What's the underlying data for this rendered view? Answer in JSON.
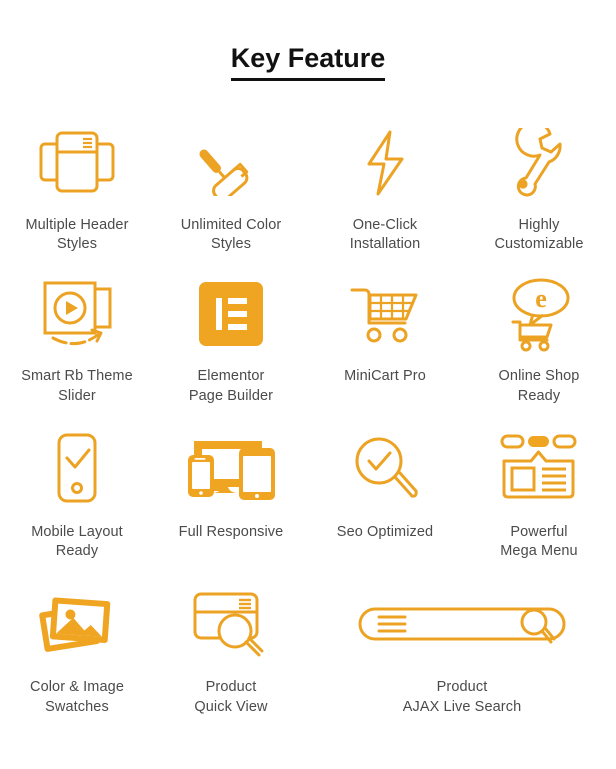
{
  "header": {
    "title": "Key Feature"
  },
  "colors": {
    "accent": "#eca324",
    "accent_solid": "#efa521",
    "text": "#4b4b4b",
    "title": "#111111",
    "background": "#ffffff"
  },
  "features": [
    {
      "id": "multiple-header-styles",
      "icon": "header-layers-icon",
      "label_line1": "Multiple Header",
      "label_line2": "Styles"
    },
    {
      "id": "unlimited-color-styles",
      "icon": "paint-roller-icon",
      "label_line1": "Unlimited Color",
      "label_line2": "Styles"
    },
    {
      "id": "one-click-installation",
      "icon": "lightning-bolt-icon",
      "label_line1": "One-Click",
      "label_line2": "Installation"
    },
    {
      "id": "highly-customizable",
      "icon": "wrench-icon",
      "label_line1": "Highly",
      "label_line2": "Customizable"
    },
    {
      "id": "smart-rb-theme-slider",
      "icon": "slider-play-icon",
      "label_line1": "Smart Rb Theme",
      "label_line2": "Slider"
    },
    {
      "id": "elementor-page-builder",
      "icon": "elementor-logo-icon",
      "label_line1": "Elementor",
      "label_line2": "Page Builder"
    },
    {
      "id": "minicart-pro",
      "icon": "shopping-cart-icon",
      "label_line1": "MiniCart Pro",
      "label_line2": ""
    },
    {
      "id": "online-shop-ready",
      "icon": "ecommerce-bubble-cart-icon",
      "label_line1": "Online Shop",
      "label_line2": "Ready"
    },
    {
      "id": "mobile-layout-ready",
      "icon": "mobile-check-icon",
      "label_line1": "Mobile Layout",
      "label_line2": "Ready"
    },
    {
      "id": "full-responsive",
      "icon": "devices-icon",
      "label_line1": "Full Responsive",
      "label_line2": ""
    },
    {
      "id": "seo-optimized",
      "icon": "magnifier-check-icon",
      "label_line1": "Seo Optimized",
      "label_line2": ""
    },
    {
      "id": "powerful-mega-menu",
      "icon": "mega-menu-icon",
      "label_line1": "Powerful",
      "label_line2": "Mega Menu"
    },
    {
      "id": "color-image-swatches",
      "icon": "photo-stack-icon",
      "label_line1": "Color & Image",
      "label_line2": "Swatches"
    },
    {
      "id": "product-quick-view",
      "icon": "window-magnifier-icon",
      "label_line1": "Product",
      "label_line2": "Quick View"
    },
    {
      "id": "product-ajax-live-search",
      "icon": "search-bar-icon",
      "label_line1": "Product",
      "label_line2": "AJAX Live Search"
    }
  ]
}
